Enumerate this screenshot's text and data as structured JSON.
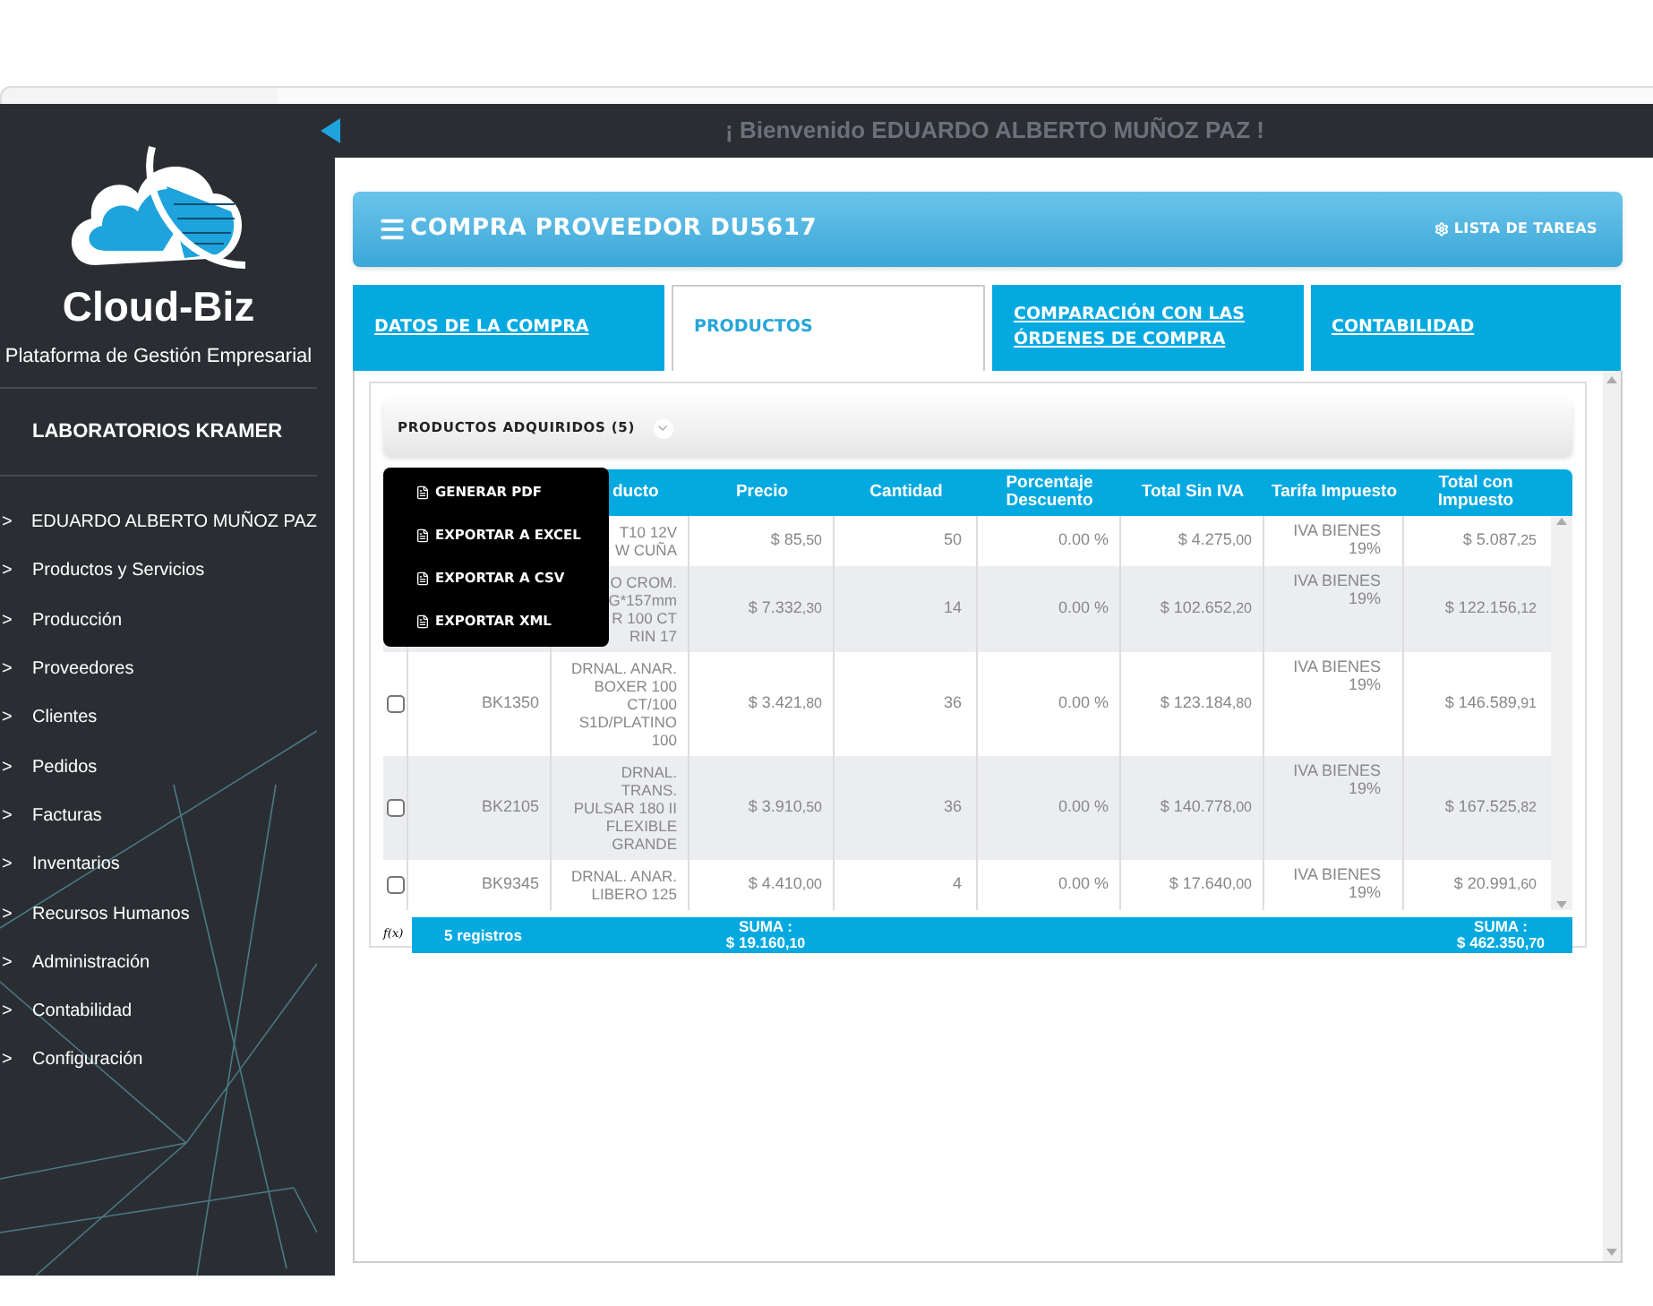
{
  "sidebar": {
    "brand": "Cloud-Biz",
    "tagline": "Plataforma de Gestión Empresarial",
    "company": "LABORATORIOS KRAMER",
    "bullet": ">",
    "items": [
      {
        "label": "EDUARDO ALBERTO MUÑOZ PAZ"
      },
      {
        "label": "Productos y Servicios"
      },
      {
        "label": "Producción"
      },
      {
        "label": "Proveedores"
      },
      {
        "label": "Clientes"
      },
      {
        "label": "Pedidos"
      },
      {
        "label": "Facturas"
      },
      {
        "label": "Inventarios"
      },
      {
        "label": "Recursos Humanos"
      },
      {
        "label": "Administración"
      },
      {
        "label": "Contabilidad"
      },
      {
        "label": "Configuración"
      }
    ]
  },
  "top_bar": {
    "welcome": "¡ Bienvenido EDUARDO ALBERTO MUÑOZ PAZ !"
  },
  "header": {
    "title": "COMPRA PROVEEDOR DU5617",
    "action": "LISTA DE TAREAS"
  },
  "tabs": [
    {
      "label": "DATOS DE LA COMPRA",
      "selected": false
    },
    {
      "label": "PRODUCTOS",
      "selected": true
    },
    {
      "label": "COMPARACIÓN CON LAS ÓRDENES DE COMPRA",
      "selected": false
    },
    {
      "label": "CONTABILIDAD",
      "selected": false
    }
  ],
  "section": {
    "title": "PRODUCTOS ADQUIRIDOS (5)"
  },
  "export_menu": [
    {
      "label": "GENERAR PDF"
    },
    {
      "label": "EXPORTAR A EXCEL"
    },
    {
      "label": "EXPORTAR A CSV"
    },
    {
      "label": "EXPORTAR XML"
    }
  ],
  "table": {
    "columns": [
      "ducto",
      "Precio",
      "Cantidad",
      "Porcentaje Descuento",
      "Total Sin IVA",
      "Tarifa Impuesto",
      "Total con Impuesto"
    ],
    "rows": [
      {
        "product": [
          "T10 12V",
          "W CUÑA"
        ],
        "price": [
          "$ 85",
          ",50"
        ],
        "qty": "50",
        "discount": "0.00 %",
        "subtotal": [
          "$ 4.275",
          ",00"
        ],
        "tax": "IVA BIENES 19%",
        "total": [
          "$ 5.087",
          ",25"
        ]
      },
      {
        "product": [
          "O CROM.",
          "G*157mm",
          "R 100 CT",
          "RIN 17"
        ],
        "price": [
          "$ 7.332",
          ",30"
        ],
        "qty": "14",
        "discount": "0.00 %",
        "subtotal": [
          "$ 102.652",
          ",20"
        ],
        "tax": "IVA BIENES 19%",
        "total": [
          "$ 122.156",
          ",12"
        ]
      },
      {
        "checked": false,
        "code": "BK1350",
        "product": [
          "DRNAL. ANAR.",
          "BOXER 100",
          "CT/100",
          "S1D/PLATINO",
          "100"
        ],
        "price": [
          "$ 3.421",
          ",80"
        ],
        "qty": "36",
        "discount": "0.00 %",
        "subtotal": [
          "$ 123.184",
          ",80"
        ],
        "tax": "IVA BIENES 19%",
        "total": [
          "$ 146.589",
          ",91"
        ]
      },
      {
        "checked": false,
        "code": "BK2105",
        "product": [
          "DRNAL.",
          "TRANS.",
          "PULSAR 180 II",
          "FLEXIBLE",
          "GRANDE"
        ],
        "price": [
          "$ 3.910",
          ",50"
        ],
        "qty": "36",
        "discount": "0.00 %",
        "subtotal": [
          "$ 140.778",
          ",00"
        ],
        "tax": "IVA BIENES 19%",
        "total": [
          "$ 167.525",
          ",82"
        ]
      },
      {
        "checked": false,
        "code": "BK9345",
        "product": [
          "DRNAL. ANAR.",
          "LIBERO 125"
        ],
        "price": [
          "$ 4.410",
          ",00"
        ],
        "qty": "4",
        "discount": "0.00 %",
        "subtotal": [
          "$ 17.640",
          ",00"
        ],
        "tax": "IVA BIENES 19%",
        "total": [
          "$ 20.991",
          ",60"
        ]
      }
    ],
    "footer": {
      "formula": "f(x)",
      "count": "5 registros",
      "price_sum_label": "SUMA :",
      "total_sum_label": "SUMA :",
      "price_sum": [
        "$ 19.160",
        ",10"
      ],
      "total_sum": [
        "$ 462.350",
        ",70"
      ]
    }
  }
}
